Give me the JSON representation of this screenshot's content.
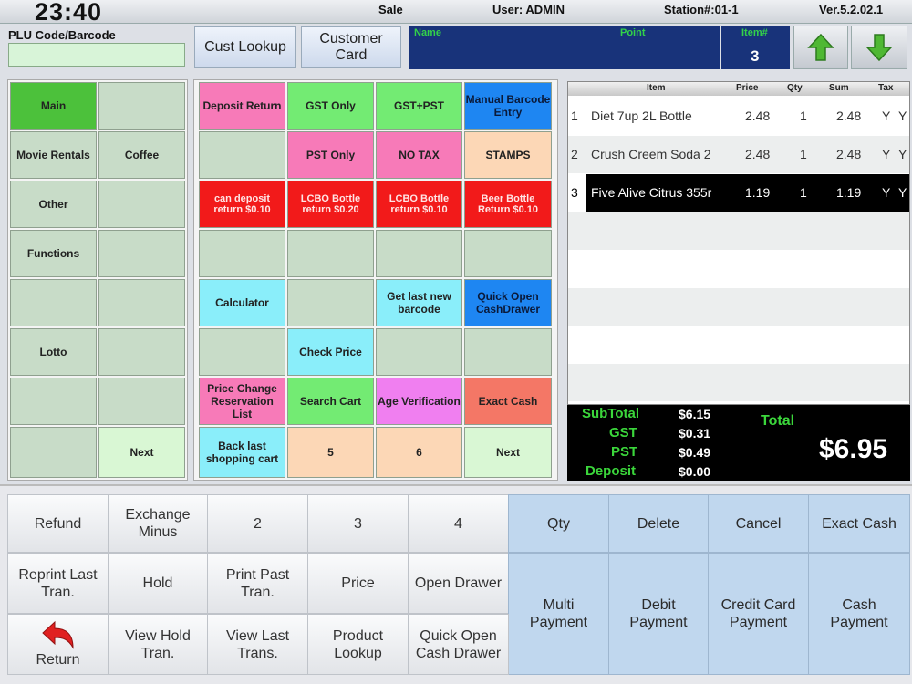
{
  "topbar": {
    "time": "23:40",
    "mode": "Sale",
    "user": "User: ADMIN",
    "station": "Station#:01-1",
    "version": "Ver.5.2.02.1"
  },
  "header": {
    "plu_label": "PLU Code/Barcode",
    "plu_value": "",
    "cust_lookup": "Cust Lookup",
    "customer_card": "Customer Card",
    "name_label": "Name",
    "point_label": "Point",
    "items_label": "Item#",
    "items_count": "3",
    "icons": [
      "arrow-up-icon",
      "arrow-down-icon"
    ]
  },
  "categories": {
    "col1": [
      "Main",
      "Movie Rentals",
      "Other",
      "Functions",
      "",
      "Lotto",
      "",
      ""
    ],
    "col2": [
      "",
      "Coffee",
      "",
      "",
      "",
      "",
      "",
      "Next"
    ]
  },
  "keys": [
    [
      "Deposit Return",
      "GST Only",
      "GST+PST",
      "Manual Barcode Entry"
    ],
    [
      "",
      "PST Only",
      "NO TAX",
      "STAMPS"
    ],
    [
      "can deposit return $0.10",
      "LCBO Bottle return $0.20",
      "LCBO Bottle return $0.10",
      "Beer Bottle Return $0.10"
    ],
    [
      "",
      "",
      "",
      ""
    ],
    [
      "Calculator",
      "",
      "Get last new barcode",
      "Quick Open CashDrawer"
    ],
    [
      "",
      "Check Price",
      "",
      ""
    ],
    [
      "Price Change Reservation List",
      "Search Cart",
      "Age Verification",
      "Exact Cash"
    ],
    [
      "Back last shopping cart",
      "5",
      "6",
      "Next"
    ]
  ],
  "transaction": {
    "headers": [
      "Item",
      "Price",
      "Qty",
      "Sum",
      "Tax"
    ],
    "rows": [
      {
        "no": "1",
        "item": "Diet 7up 2L Bottle",
        "price": "2.48",
        "qty": "1",
        "sum": "2.48",
        "t1": "Y",
        "t2": "Y"
      },
      {
        "no": "2",
        "item": "Crush Creem Soda 2",
        "price": "2.48",
        "qty": "1",
        "sum": "2.48",
        "t1": "Y",
        "t2": "Y"
      },
      {
        "no": "3",
        "item": "Five Alive Citrus 355r",
        "price": "1.19",
        "qty": "1",
        "sum": "1.19",
        "t1": "Y",
        "t2": "Y"
      }
    ],
    "selected_index": 2
  },
  "totals": {
    "subtotal_label": "SubTotal",
    "subtotal": "$6.15",
    "gst_label": "GST",
    "gst": "$0.31",
    "pst_label": "PST",
    "pst": "$0.49",
    "deposit_label": "Deposit",
    "deposit": "$0.00",
    "total_label": "Total",
    "total": "$6.95"
  },
  "bottom": {
    "refund": "Refund",
    "exchange_minus": "Exchange Minus",
    "b2": "2",
    "b3": "3",
    "b4": "4",
    "qty": "Qty",
    "delete": "Delete",
    "cancel": "Cancel",
    "exact_cash": "Exact Cash",
    "reprint": "Reprint Last Tran.",
    "hold": "Hold",
    "print_past": "Print Past Tran.",
    "price": "Price",
    "open_drawer": "Open Drawer",
    "multi_payment": "Multi Payment",
    "debit_payment": "Debit Payment",
    "credit_payment": "Credit Card Payment",
    "cash_payment": "Cash Payment",
    "return": "Return",
    "view_hold": "View Hold Tran.",
    "view_last": "View Last Trans.",
    "product_lookup": "Product Lookup",
    "quick_open": "Quick Open Cash Drawer",
    "return_icon": "return-arrow-icon"
  },
  "colors": {
    "selected_category": "#4cc13b",
    "header_blue": "#18337a",
    "total_green": "#3bd63b",
    "red_key": "#f21a1a"
  }
}
